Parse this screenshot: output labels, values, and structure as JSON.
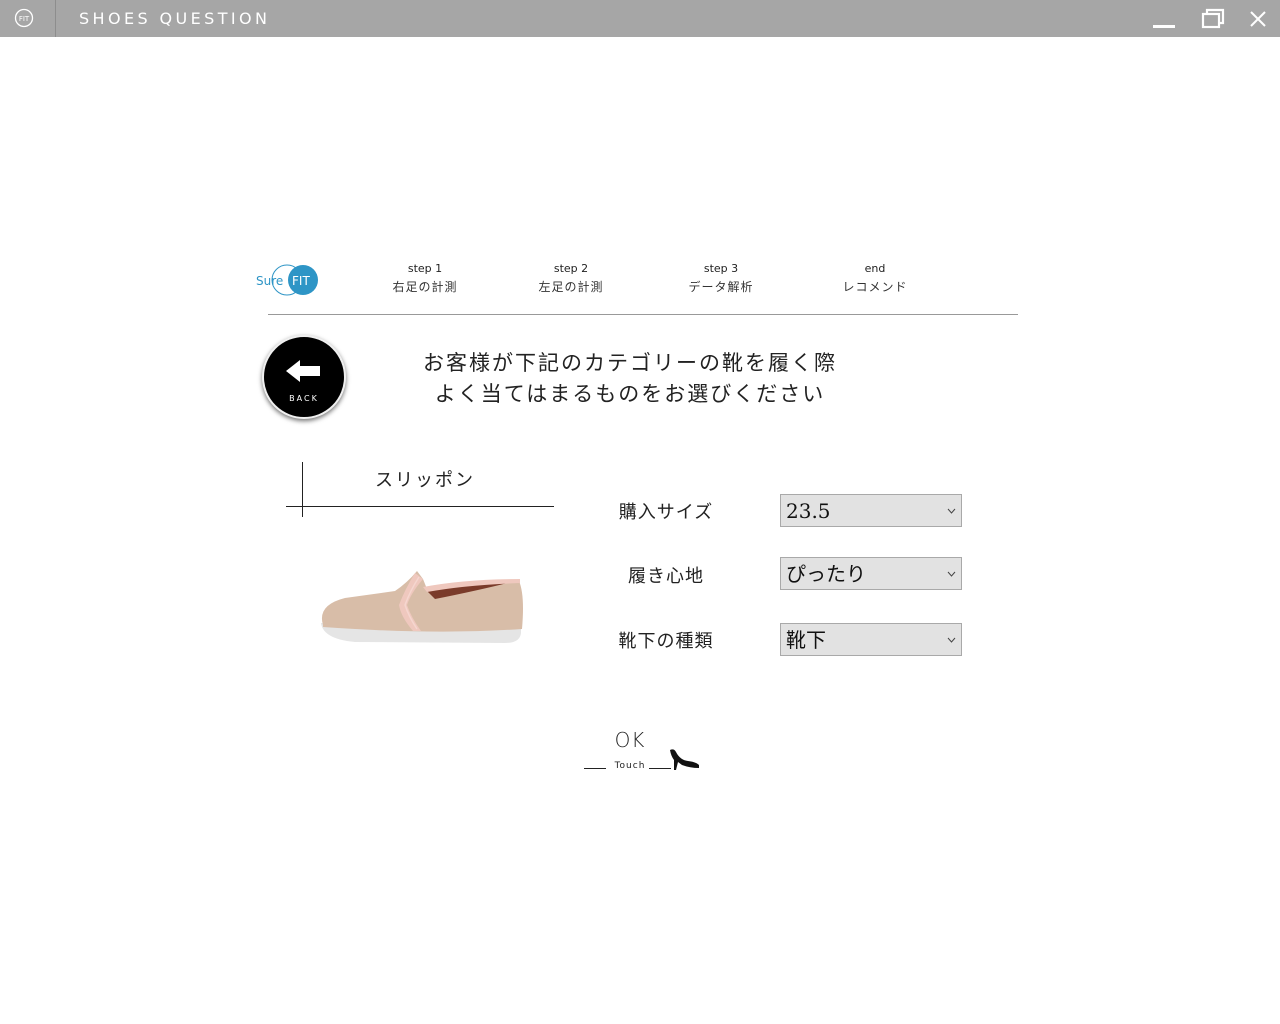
{
  "window": {
    "title": "SHOES QUESTION",
    "logo_text": "FIT"
  },
  "brand": {
    "logo_left": "Sure",
    "logo_right": "FIT",
    "accent_color": "#2e95c6"
  },
  "steps": [
    {
      "num": "step 1",
      "label": "右足の計測"
    },
    {
      "num": "step 2",
      "label": "左足の計測"
    },
    {
      "num": "step 3",
      "label": "データ解析"
    },
    {
      "num": "end",
      "label": "レコメンド"
    }
  ],
  "back_button": {
    "label": "BACK"
  },
  "instruction": {
    "line1": "お客様が下記のカテゴリーの靴を履く際",
    "line2": "よく当てはまるものをお選びください"
  },
  "category": {
    "label": "スリッポン",
    "icon": "slip-on-shoe"
  },
  "form": {
    "size": {
      "label": "購入サイズ",
      "value": "23.5"
    },
    "fit": {
      "label": "履き心地",
      "value": "ぴったり"
    },
    "sock": {
      "label": "靴下の種類",
      "value": "靴下"
    }
  },
  "ok_button": {
    "label": "OK",
    "sub_label": "Touch",
    "icon": "high-heel-icon"
  }
}
